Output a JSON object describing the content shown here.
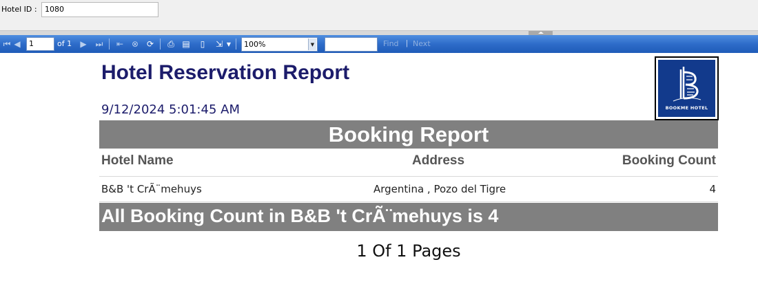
{
  "parameters": {
    "hotel_id_label": "Hotel ID :",
    "hotel_id_value": "1080"
  },
  "toolbar": {
    "page_current": "1",
    "page_of": "of  1",
    "zoom_value": "100%",
    "find_label": "Find",
    "find_separator": "|",
    "next_label": "Next",
    "icons": [
      "first-page-icon",
      "previous-page-icon",
      "next-page-icon",
      "last-page-icon",
      "back-icon",
      "stop-icon",
      "refresh-icon",
      "print-icon",
      "print-layout-icon",
      "page-setup-icon",
      "export-icon"
    ]
  },
  "report": {
    "title": "Hotel Reservation Report",
    "date": "9/12/2024 5:01:45 AM",
    "logo_text": "BOOKME HOTEL",
    "section_title": "Booking Report",
    "columns": {
      "hotel_name": "Hotel Name",
      "address": "Address",
      "booking_count": "Booking Count"
    },
    "rows": [
      {
        "hotel_name": "B&B 't CrÃ¨mehuys",
        "address": "Argentina , Pozo del Tigre",
        "booking_count": "4"
      }
    ],
    "total_text": "All Booking Count in B&B 't CrÃ¨mehuys is 4",
    "page_footer": "1 Of 1 Pages"
  },
  "colors": {
    "toolbar_blue": "#2e6cc9",
    "title_navy": "#1c1c6b",
    "band_gray": "#808080",
    "logo_blue": "#123a8c"
  }
}
